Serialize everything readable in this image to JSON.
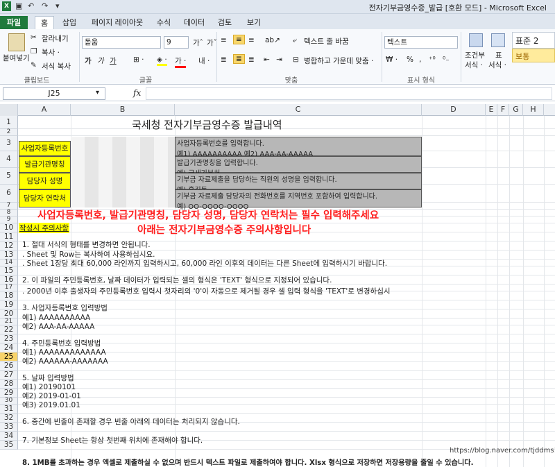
{
  "window": {
    "title": "전자기부금영수증_발급  [호환 모드]  -  Microsoft Excel",
    "qa_icons": [
      "excel-logo-icon",
      "save-icon",
      "undo-icon",
      "redo-icon"
    ]
  },
  "tabs": [
    "파일",
    "홈",
    "삽입",
    "페이지 레이아웃",
    "수식",
    "데이터",
    "검토",
    "보기"
  ],
  "ribbon": {
    "clipboard": {
      "paste": "붙여넣기",
      "cut": "잘라내기",
      "copy": "복사 ·",
      "format_painter": "서식 복사",
      "label": "클립보드"
    },
    "font": {
      "name": "돋움",
      "size": "9",
      "label": "글꼴"
    },
    "align": {
      "wrap": "텍스트 줄 바꿈",
      "merge": "병합하고 가운데 맞춤 ·",
      "label": "맞춤"
    },
    "number": {
      "format": "텍스트",
      "percent": "%",
      "comma": ",",
      "label": "표시 형식"
    },
    "styles": {
      "conditional_1": "조건부",
      "conditional_2": "서식 ·",
      "table_1": "표",
      "table_2": "서식 ·",
      "normal_style": "표준 2",
      "normal_badge": "보통"
    }
  },
  "formula_bar": {
    "name_box": "J25",
    "fx": "fx",
    "value": ""
  },
  "columns": [
    "A",
    "B",
    "C",
    "D",
    "E",
    "F",
    "G",
    "H"
  ],
  "rows": [
    "1",
    "2",
    "3",
    "4",
    "5",
    "6",
    "7",
    "8",
    "9",
    "10",
    "11",
    "12",
    "13",
    "14",
    "15",
    "16",
    "17",
    "18",
    "19",
    "20",
    "21",
    "22",
    "23",
    "24",
    "25",
    "26",
    "27",
    "28",
    "29",
    "30",
    "31",
    "32",
    "33",
    "34",
    "35"
  ],
  "selected_row": "25",
  "sheet": {
    "title": "국세청 전자기부금영수증 발급내역",
    "labels": [
      "사업자등록번호",
      "발급기관명칭",
      "담당자 성명",
      "담당자 연락처"
    ],
    "hints": [
      "사업자등록번호를 입력합니다.",
      "예1) AAAAAAAAAA             예2) AAA-AA-AAAAA",
      "발급기관명칭을 입력합니다.",
      "예) 국세기부처",
      "기부금 자료제출을 담당하는 직원의 성명을 입력합니다.",
      "예) 홍길동",
      "기부금 자료제출 담당자의 전화번호를 지역번호 포함하여 입력합니다.",
      "예) OO-OOOO-OOOO"
    ],
    "red_note_1": "사업자등록번호, 발급기관명칭, 담당자 성명, 담당자 연락처는 필수 입력해주세요",
    "red_note_2": "아래는 전자기부금영수증 주의사항입니다",
    "notice_label": "작성시 주의사항",
    "lines": {
      "r11": "1. 절대 서식의 형태를 변경하면 안됩니다.",
      "r12": "   . Sheet 및 Row는 복사하여 사용하십시요.",
      "r13": "   . Sheet 1장당 최대 60,000 라인까지 입력하시고, 60,000 라인 이후의 데이터는 다른 Sheet에 입력하시기 바랍니다.",
      "r15": "2. 이 파일의 주민등록번호, 날짜 데이터가 입력되는 셀의 형식은 'TEXT' 형식으로 지정되어 있습니다.",
      "r16": "   . 2000년 이후 출생자의 주민등록번호 입력시 첫자리의 '0'이 자동으로 제거될 경우 셀 입력 형식을 'TEXT'로 변경하십시",
      "r18": "3. 사업자등록번호 입력방법",
      "r19": "     예1) AAAAAAAAAA",
      "r20": "     예2) AAA-AA-AAAAA",
      "r22": "4. 주민등록번호 입력방법",
      "r23": "     예1) AAAAAAAAAAAAA",
      "r24": "     예2) AAAAAA-AAAAAAA",
      "r26": "5. 날짜 입력방법",
      "r27": "     예1) 20190101",
      "r28": "     예2) 2019-01-01",
      "r29": "     예3) 2019.01.01",
      "r31": "6. 중간에 빈줄이 존재할 경우 빈줄 아래의 데이터는 처리되지 않습니다.",
      "r33": "7. 기본정보 Sheet는 항상 첫번째 위치에 존재해야 합니다.",
      "r35": "8. 1MB를 초과하는 경우 엑셀로 제출하실 수 없으며 반드시 텍스트 파일로 제출하여야 합니다. Xlsx 형식으로 저장하면 저장용량을 줄일 수 있습니다."
    },
    "watermark": "https://blog.naver.com/tjddms153"
  },
  "colors": {
    "file_tab": "#1f7a3c",
    "selected_row": "#f7d36a",
    "red_note": "#ff1e1e",
    "yellow_cell": "#ffff00",
    "gray_cell": "#b7b7b7"
  }
}
